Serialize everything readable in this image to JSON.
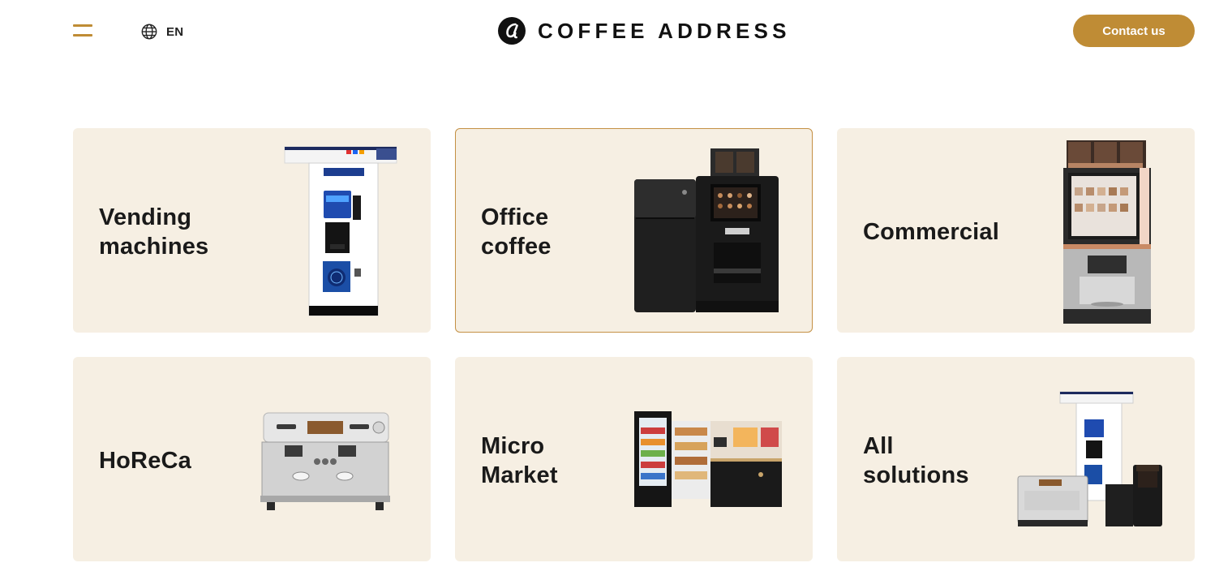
{
  "header": {
    "menu_icon": "hamburger-menu-icon",
    "language": {
      "icon": "globe-icon",
      "label": "EN"
    },
    "logo": {
      "mark": "coffee-address-logo-mark",
      "text": "COFFEE ADDRESS"
    },
    "contact_button": "Contact us"
  },
  "colors": {
    "accent": "#bf8c35",
    "card_background": "#f6efe3",
    "active_border": "#c49044",
    "text": "#1a1a1a"
  },
  "categories": [
    {
      "title": "Vending\nmachines",
      "image": "lavazza-vending-machine-image",
      "active": false
    },
    {
      "title": "Office\ncoffee",
      "image": "office-coffee-machine-image",
      "active": true
    },
    {
      "title": "Commercial",
      "image": "commercial-coffee-machine-image",
      "active": false
    },
    {
      "title": "HoReCa",
      "image": "espresso-machine-image",
      "active": false
    },
    {
      "title": "Micro\nMarket",
      "image": "micro-market-kiosk-image",
      "active": false
    },
    {
      "title": "All\nsolutions",
      "image": "all-solutions-machines-image",
      "active": false
    }
  ]
}
